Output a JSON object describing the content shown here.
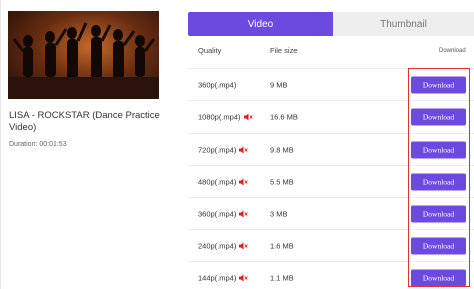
{
  "video": {
    "title": "LISA - ROCKSTAR (Dance Practice Video)",
    "duration": "Duration: 00:01:53"
  },
  "tabs": [
    {
      "label": "Video",
      "active": true
    },
    {
      "label": "Thumbnail",
      "active": false
    }
  ],
  "table": {
    "headers": {
      "quality": "Quality",
      "size": "File size",
      "download": "Download"
    },
    "rows": [
      {
        "quality": "360p(.mp4)",
        "size": "9 MB",
        "muted": false,
        "button": "Download"
      },
      {
        "quality": "1080p(.mp4)",
        "size": "16.6 MB",
        "muted": true,
        "button": "Download"
      },
      {
        "quality": "720p(.mp4)",
        "size": "9.8 MB",
        "muted": true,
        "button": "Download"
      },
      {
        "quality": "480p(.mp4)",
        "size": "5.5 MB",
        "muted": true,
        "button": "Download"
      },
      {
        "quality": "360p(.mp4)",
        "size": "3 MB",
        "muted": true,
        "button": "Download"
      },
      {
        "quality": "240p(.mp4)",
        "size": "1.6 MB",
        "muted": true,
        "button": "Download"
      },
      {
        "quality": "144p(.mp4)",
        "size": "1.1 MB",
        "muted": true,
        "button": "Download"
      }
    ]
  },
  "icons": {
    "muted": "speaker-muted-icon"
  },
  "colors": {
    "accent": "#6c4ae0",
    "highlight": "#e03030",
    "mute_icon": "#e02020"
  }
}
